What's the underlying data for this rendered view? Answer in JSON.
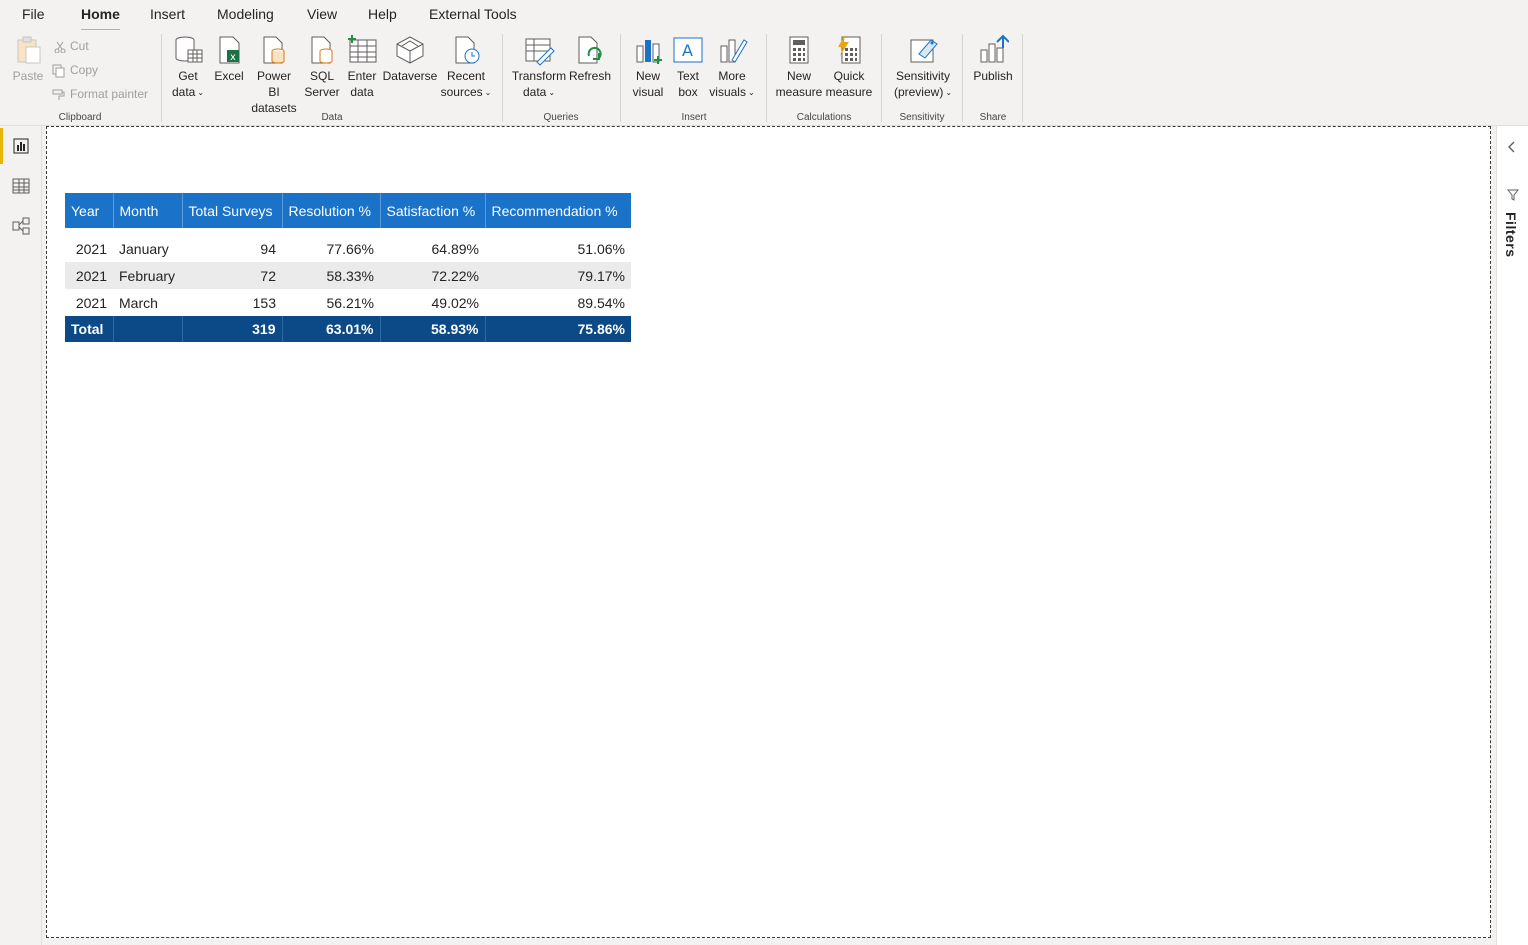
{
  "menu": {
    "tabs": [
      {
        "label": "File"
      },
      {
        "label": "Home"
      },
      {
        "label": "Insert"
      },
      {
        "label": "Modeling"
      },
      {
        "label": "View"
      },
      {
        "label": "Help"
      },
      {
        "label": "External Tools"
      }
    ],
    "active": "Home"
  },
  "ribbon": {
    "clipboard": {
      "label": "Clipboard",
      "paste": "Paste",
      "cut": "Cut",
      "copy": "Copy",
      "format_painter": "Format painter"
    },
    "data": {
      "label": "Data",
      "get_data": "Get\ndata",
      "excel": "Excel",
      "power_bi_datasets": "Power BI\ndatasets",
      "sql_server": "SQL\nServer",
      "enter_data": "Enter\ndata",
      "dataverse": "Dataverse",
      "recent_sources": "Recent\nsources"
    },
    "queries": {
      "label": "Queries",
      "transform_data": "Transform\ndata",
      "refresh": "Refresh"
    },
    "insert": {
      "label": "Insert",
      "new_visual": "New\nvisual",
      "text_box": "Text\nbox",
      "more_visuals": "More\nvisuals"
    },
    "calculations": {
      "label": "Calculations",
      "new_measure": "New\nmeasure",
      "quick_measure": "Quick\nmeasure"
    },
    "sensitivity": {
      "label": "Sensitivity",
      "sensitivity_preview": "Sensitivity\n(preview)"
    },
    "share": {
      "label": "Share",
      "publish": "Publish"
    }
  },
  "right_pane": {
    "filters_label": "Filters"
  },
  "table": {
    "headers": [
      "Year",
      "Month",
      "Total Surveys",
      "Resolution %",
      "Satisfaction %",
      "Recommendation %"
    ],
    "rows": [
      [
        "2021",
        "January",
        "94",
        "77.66%",
        "64.89%",
        "51.06%"
      ],
      [
        "2021",
        "February",
        "72",
        "58.33%",
        "72.22%",
        "79.17%"
      ],
      [
        "2021",
        "March",
        "153",
        "56.21%",
        "49.02%",
        "89.54%"
      ]
    ],
    "total": [
      "Total",
      "",
      "319",
      "63.01%",
      "58.93%",
      "75.86%"
    ]
  },
  "colors": {
    "header_bg": "#1a73c9",
    "total_bg": "#0b4a86",
    "accent": "#e8b500"
  }
}
